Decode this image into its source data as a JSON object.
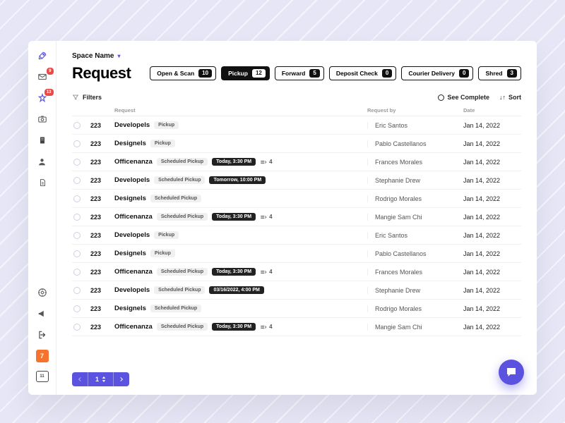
{
  "sidebar": {
    "badges": {
      "mail": "9",
      "alerts": "13"
    },
    "app_label": "7",
    "counter": "11"
  },
  "header": {
    "space_name": "Space Name",
    "title": "Request"
  },
  "tabs": [
    {
      "label": "Open & Scan",
      "count": "10",
      "active": false
    },
    {
      "label": "Pickup",
      "count": "12",
      "active": true
    },
    {
      "label": "Forward",
      "count": "5",
      "active": false
    },
    {
      "label": "Deposit Check",
      "count": "0",
      "active": false
    },
    {
      "label": "Courier Delivery",
      "count": "0",
      "active": false
    },
    {
      "label": "Shred",
      "count": "3",
      "active": false
    }
  ],
  "toolbar": {
    "filters_label": "Filters",
    "see_complete": "See Complete",
    "sort": "Sort"
  },
  "columns": {
    "request": "Request",
    "request_by": "Request by",
    "date": "Date"
  },
  "rows": [
    {
      "id": "223",
      "name": "Developels",
      "tags": [
        "Pickup"
      ],
      "time": null,
      "bundle": null,
      "by": "Eric Santos",
      "date": "Jan 14, 2022"
    },
    {
      "id": "223",
      "name": "Designels",
      "tags": [
        "Pickup"
      ],
      "time": null,
      "bundle": null,
      "by": "Pablo Castellanos",
      "date": "Jan 14, 2022"
    },
    {
      "id": "223",
      "name": "Officenanza",
      "tags": [
        "Scheduled Pickup"
      ],
      "time": "Today, 3:30 PM",
      "bundle": "4",
      "by": "Frances Morales",
      "date": "Jan 14, 2022"
    },
    {
      "id": "223",
      "name": "Developels",
      "tags": [
        "Scheduled Pickup"
      ],
      "time": "Tomorrow, 10:00 PM",
      "bundle": null,
      "by": "Stephanie Drew",
      "date": "Jan 14, 2022"
    },
    {
      "id": "223",
      "name": "Designels",
      "tags": [
        "Scheduled Pickup"
      ],
      "time": null,
      "bundle": null,
      "by": "Rodrigo Morales",
      "date": "Jan 14, 2022"
    },
    {
      "id": "223",
      "name": "Officenanza",
      "tags": [
        "Scheduled Pickup"
      ],
      "time": "Today, 3:30 PM",
      "bundle": "4",
      "by": "Mangie Sam Chi",
      "date": "Jan 14, 2022"
    },
    {
      "id": "223",
      "name": "Developels",
      "tags": [
        "Pickup"
      ],
      "time": null,
      "bundle": null,
      "by": "Eric Santos",
      "date": "Jan 14, 2022"
    },
    {
      "id": "223",
      "name": "Designels",
      "tags": [
        "Pickup"
      ],
      "time": null,
      "bundle": null,
      "by": "Pablo Castellanos",
      "date": "Jan 14, 2022"
    },
    {
      "id": "223",
      "name": "Officenanza",
      "tags": [
        "Scheduled Pickup"
      ],
      "time": "Today, 3:30 PM",
      "bundle": "4",
      "by": "Frances Morales",
      "date": "Jan 14, 2022"
    },
    {
      "id": "223",
      "name": "Developels",
      "tags": [
        "Scheduled Pickup"
      ],
      "time": "03/16/2022, 4:00 PM",
      "bundle": null,
      "by": "Stephanie Drew",
      "date": "Jan 14, 2022"
    },
    {
      "id": "223",
      "name": "Designels",
      "tags": [
        "Scheduled Pickup"
      ],
      "time": null,
      "bundle": null,
      "by": "Rodrigo Morales",
      "date": "Jan 14, 2022"
    },
    {
      "id": "223",
      "name": "Officenanza",
      "tags": [
        "Scheduled Pickup"
      ],
      "time": "Today, 3:30 PM",
      "bundle": "4",
      "by": "Mangie Sam Chi",
      "date": "Jan 14, 2022"
    }
  ],
  "pagination": {
    "current": "1"
  }
}
